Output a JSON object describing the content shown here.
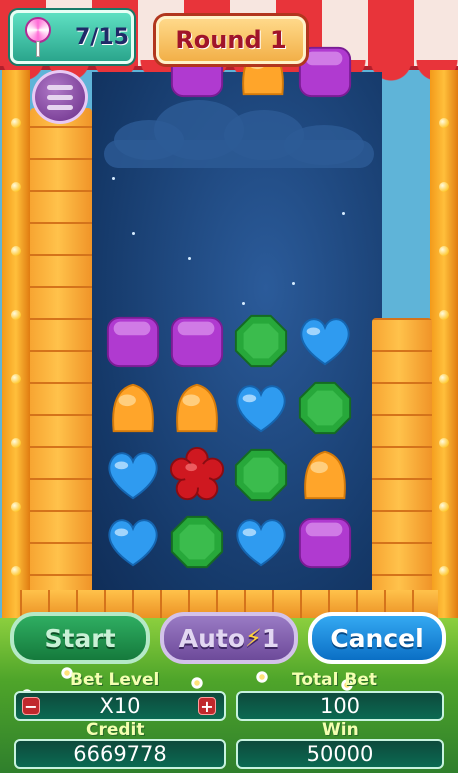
{
  "hud": {
    "progress": "7/15",
    "round_label": "Round 1",
    "menu_icon": "hamburger-menu-icon",
    "counter_icon": "lollipop-icon"
  },
  "board": {
    "grid_rows": [
      [
        "purple-square",
        "purple-square",
        "green-octagon",
        "blue-heart"
      ],
      [
        "orange-gumdrop",
        "orange-gumdrop",
        "blue-heart",
        "green-octagon"
      ],
      [
        "blue-heart",
        "red-flower",
        "green-octagon",
        "orange-gumdrop"
      ],
      [
        "blue-heart",
        "green-octagon",
        "blue-heart",
        "purple-square"
      ]
    ],
    "falling_top": [
      "purple-square",
      "orange-gumdrop",
      "purple-square"
    ]
  },
  "buttons": {
    "start": "Start",
    "auto": "Auto",
    "auto_count": "1",
    "cancel": "Cancel"
  },
  "panel": {
    "bet_level_label": "Bet Level",
    "bet_level_value": "X10",
    "total_bet_label": "Total Bet",
    "total_bet_value": "100",
    "credit_label": "Credit",
    "credit_value": "6669778",
    "win_label": "Win",
    "win_value": "50000",
    "minus": "−",
    "plus": "+"
  },
  "colors": {
    "purple": "#b03ad0",
    "orange": "#ffa52a",
    "green": "#27a83a",
    "blue": "#2f9bf0",
    "red": "#cf1820"
  }
}
